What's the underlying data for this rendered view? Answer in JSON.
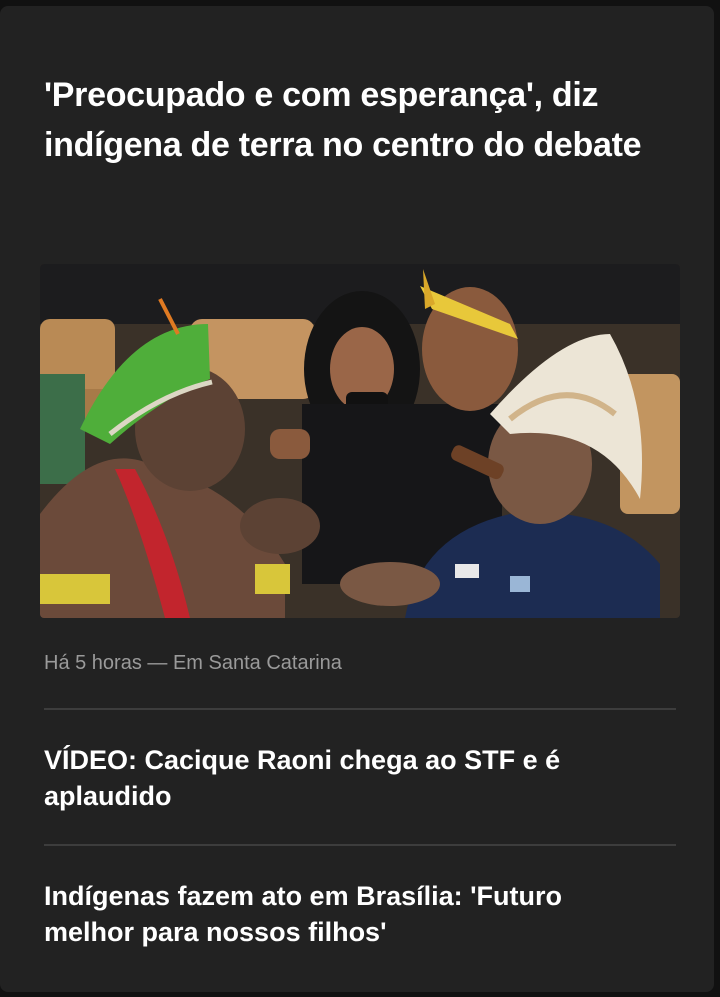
{
  "main_story": {
    "headline": "'Preocupado e com esperança', diz indígena de terra no centro do debate",
    "meta": "Há 5 horas — Em Santa Catarina"
  },
  "related": [
    {
      "title": "VÍDEO: Cacique Raoni chega ao STF e é aplaudido"
    },
    {
      "title": "Indígenas fazem ato em Brasília: 'Futuro melhor para nossos filhos'"
    }
  ],
  "colors": {
    "background": "#111111",
    "card": "#222222",
    "text": "#ffffff",
    "meta_text": "#9a9a9a",
    "divider": "#3d3d3d"
  }
}
